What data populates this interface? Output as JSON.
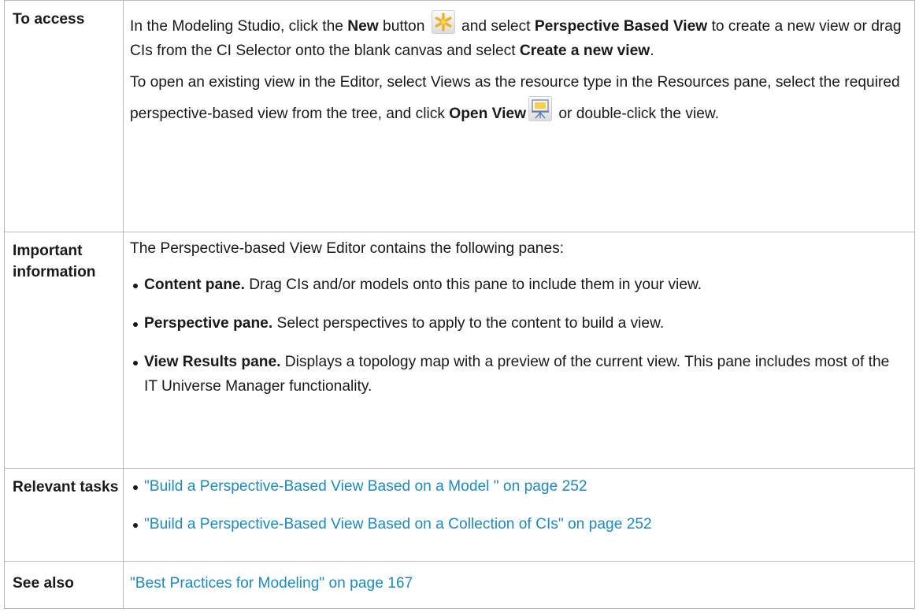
{
  "rows": {
    "access": {
      "header": "To access",
      "p1": {
        "t1": "In the Modeling Studio, click the ",
        "b1": "New",
        "t2": " button ",
        "t3": " and select ",
        "b2": "Perspective Based View",
        "t4": " to create a new view or drag CIs from the CI Selector onto the blank canvas and select ",
        "b3": "Create a new view",
        "t5": "."
      },
      "p2": {
        "t1": "To open an existing view in the Editor, select Views as the resource type in the Resources pane, select the required perspective-based view from the tree, and click ",
        "b1": "Open View",
        "t2": " or double-click the view."
      },
      "icons": {
        "new": "new-asterisk-icon",
        "open": "open-view-icon"
      }
    },
    "important": {
      "header": "Important information",
      "intro": "The Perspective-based View Editor contains the following panes:",
      "items": [
        {
          "bold": "Content pane.",
          "text": " Drag CIs and/or models onto this pane to include them in your view."
        },
        {
          "bold": "Perspective pane.",
          "text": " Select perspectives to apply to the content to build a view."
        },
        {
          "bold": "View Results pane.",
          "text": " Displays a topology map with a preview of the current view. This pane includes most of the IT Universe Manager functionality."
        }
      ]
    },
    "tasks": {
      "header": "Relevant tasks",
      "links": [
        "\"Build a Perspective-Based View Based on a Model \" on page 252",
        "\"Build a Perspective-Based View Based on a Collection of CIs\" on page 252"
      ]
    },
    "see_also": {
      "header": "See also",
      "link": "\"Best Practices for Modeling\" on page 167"
    }
  },
  "colors": {
    "link": "#1a8ac6",
    "border": "#b9b9b9",
    "text": "#1a1a1a"
  }
}
